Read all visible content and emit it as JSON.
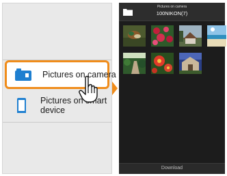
{
  "left_menu": {
    "items": [
      {
        "label": "Pictures on camera",
        "icon": "camera-icon",
        "selected": true
      },
      {
        "label": "Pictures on smart device",
        "icon": "smartphone-icon",
        "selected": false
      }
    ]
  },
  "right_screen": {
    "header": {
      "title": "Pictures on camera",
      "subtitle": "100NIKON(7)",
      "icon": "folder-icon"
    },
    "thumbnails": [
      "duck-photo",
      "flowers-photo",
      "house-photo",
      "beach-photo",
      "garden-path-photo",
      "red-flowers-photo",
      "building-photo"
    ],
    "footer": {
      "download_label": "Download"
    }
  },
  "colors": {
    "accent": "#f08c1a",
    "phone_icon": "#1e7fd0",
    "dark_bg": "#1c1c1c",
    "panel_bg": "#e9e9e9"
  }
}
